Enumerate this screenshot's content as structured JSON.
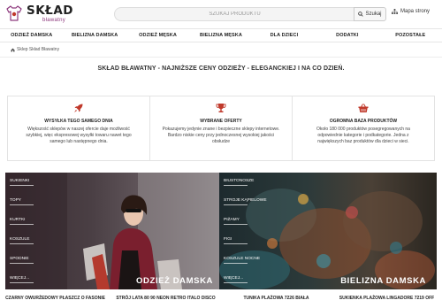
{
  "colors": {
    "brand": "#8e3a7e",
    "accent": "#c0392b"
  },
  "header": {
    "logo_title": "SKŁAD",
    "logo_subtitle": "bławatny",
    "logo_icon": "tshirt-icon",
    "search_placeholder": "SZUKAJ PRODUKTU",
    "search_button": "Szukaj",
    "search_icon": "search-icon",
    "map_label": "Mapa strony",
    "map_icon": "sitemap-icon"
  },
  "nav": {
    "items": [
      {
        "label": "ODZIEŻ DAMSKA"
      },
      {
        "label": "BIELIZNA DAMSKA"
      },
      {
        "label": "ODZIEŻ MĘSKA"
      },
      {
        "label": "BIELIZNA MĘSKA"
      },
      {
        "label": "DLA DZIECI"
      },
      {
        "label": "DODATKI"
      },
      {
        "label": "POZOSTAŁE"
      }
    ]
  },
  "breadcrumb": {
    "label": "Sklep Skład Bławatny",
    "icon": "home-icon"
  },
  "headline": "SKŁAD BŁAWATNY - NAJNIŻSZE CENY ODZIEŻY - ELEGANCKIEJ I NA CO DZIEŃ.",
  "features": [
    {
      "icon": "rocket-icon",
      "title": "WYSYŁKA TEGO SAMEGO DNIA",
      "lines": [
        "Większość sklepów w naszej ofercie daje możliwość",
        "szybkiej, więc ekspresowej wysyłki towaru nawet tego",
        "samego lub następnego dnia."
      ]
    },
    {
      "icon": "trophy-icon",
      "title": "WYBRANE OFERTY",
      "lines": [
        "Pokazujemy jedynie znane i bezpieczne sklepy internetowe.",
        "Bardzo niskie ceny przy jednoczesnej wysokiej jakości",
        "obsłudze"
      ]
    },
    {
      "icon": "basket-icon",
      "title": "OGROMNA BAZA PRODUKTÓW",
      "lines": [
        "Około 180 000 produktów posegregowanych na",
        "odpowiednie kategorie i podkategorie. Jedna z",
        "największych baz produktów dla dzieci w sieci."
      ]
    }
  ],
  "banners": {
    "left": {
      "title": "ODZIEŻ DAMSKA",
      "menu": [
        "SUKIENKI",
        "TOPY",
        "KURTKI",
        "KOSZULE",
        "SPODNIE",
        "WIĘCEJ..."
      ]
    },
    "right": {
      "title": "BIELIZNA DAMSKA",
      "menu": [
        "BIUSTONOSZE",
        "STROJE KĄPIELOWE",
        "PIŻAMY",
        "FIGI",
        "KOSZULE NOCNE",
        "WIĘCEJ..."
      ]
    }
  },
  "products": [
    {
      "name": "CZARNY OWURŻEDOWY PŁASZCZ O FASONIE"
    },
    {
      "name": "STRÓJ LATA 80 90 NEON RETRO ITALO DISCO"
    },
    {
      "name": "TUNIKA PLAŻOWA 7226 BIAŁA"
    },
    {
      "name": "SUKIENKA PLAŻOWA LINGADORE 7219 OFF"
    }
  ]
}
